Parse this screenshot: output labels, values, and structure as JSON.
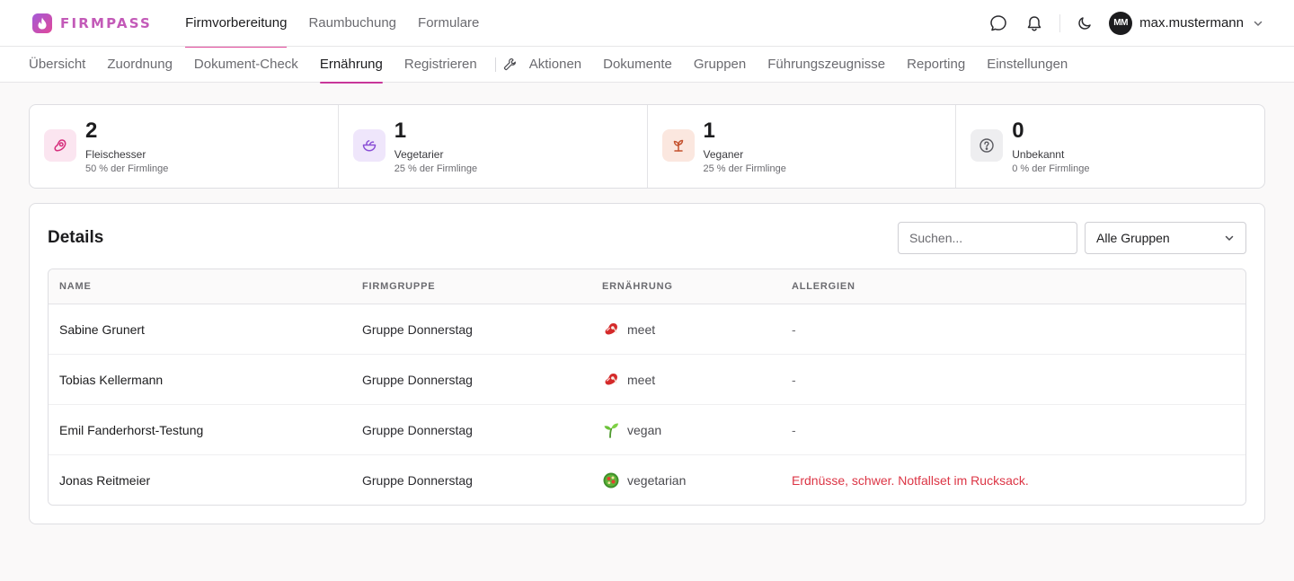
{
  "brand": {
    "name": "FIRMPASS"
  },
  "topnav": {
    "items": [
      {
        "label": "Firmvorbereitung",
        "active": true
      },
      {
        "label": "Raumbuchung",
        "active": false
      },
      {
        "label": "Formulare",
        "active": false
      }
    ]
  },
  "user": {
    "initials": "MM",
    "name": "max.mustermann"
  },
  "subnav": {
    "items": [
      {
        "label": "Übersicht",
        "active": false
      },
      {
        "label": "Zuordnung",
        "active": false
      },
      {
        "label": "Dokument-Check",
        "active": false
      },
      {
        "label": "Ernährung",
        "active": true
      },
      {
        "label": "Registrieren",
        "active": false
      },
      {
        "label": "Aktionen",
        "active": false
      },
      {
        "label": "Dokumente",
        "active": false
      },
      {
        "label": "Gruppen",
        "active": false
      },
      {
        "label": "Führungszeugnisse",
        "active": false
      },
      {
        "label": "Reporting",
        "active": false
      },
      {
        "label": "Einstellungen",
        "active": false
      }
    ]
  },
  "stats": [
    {
      "value": "2",
      "label": "Fleischesser",
      "sub": "50 % der Firmlinge",
      "icon": "meat-icon",
      "color": "#d6307e",
      "bg": "#fbe5f0"
    },
    {
      "value": "1",
      "label": "Vegetarier",
      "sub": "25 % der Firmlinge",
      "icon": "salad-bowl-icon",
      "color": "#8a4fd6",
      "bg": "#efe6fb"
    },
    {
      "value": "1",
      "label": "Veganer",
      "sub": "25 % der Firmlinge",
      "icon": "sprout-icon",
      "color": "#c4522f",
      "bg": "#fbe7df"
    },
    {
      "value": "0",
      "label": "Unbekannt",
      "sub": "0 % der Firmlinge",
      "icon": "question-circle-icon",
      "color": "#5a5a60",
      "bg": "#eeeef0"
    }
  ],
  "details": {
    "title": "Details",
    "search_placeholder": "Suchen...",
    "group_filter": "Alle Gruppen",
    "columns": {
      "name": "Name",
      "group": "Firmgruppe",
      "diet": "Ernährung",
      "allergies": "Allergien"
    },
    "rows": [
      {
        "name": "Sabine Grunert",
        "group": "Gruppe Donnerstag",
        "diet": "meet",
        "diet_icon": "meat-emoji-icon",
        "allergies": "-",
        "alert": false
      },
      {
        "name": "Tobias Kellermann",
        "group": "Gruppe Donnerstag",
        "diet": "meet",
        "diet_icon": "meat-emoji-icon",
        "allergies": "-",
        "alert": false
      },
      {
        "name": "Emil Fanderhorst-Testung",
        "group": "Gruppe Donnerstag",
        "diet": "vegan",
        "diet_icon": "seedling-emoji-icon",
        "allergies": "-",
        "alert": false
      },
      {
        "name": "Jonas Reitmeier",
        "group": "Gruppe Donnerstag",
        "diet": "vegetarian",
        "diet_icon": "salad-emoji-icon",
        "allergies": "Erdnüsse, schwer. Notfallset im Rucksack.",
        "alert": true
      }
    ]
  },
  "colors": {
    "accent": "#c8379a",
    "alert": "#dc3545"
  }
}
